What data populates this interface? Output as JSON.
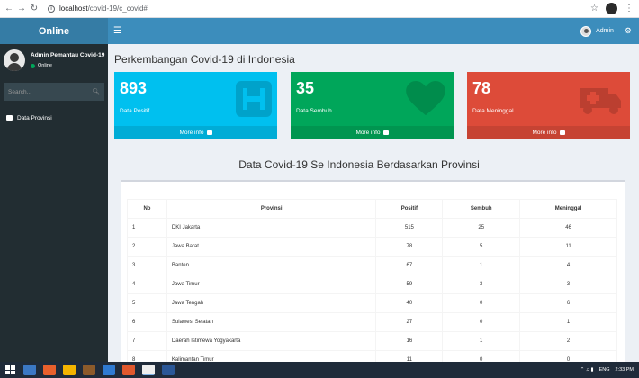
{
  "browser": {
    "url_host": "localhost",
    "url_path": "/covid-19/c_covid#"
  },
  "header": {
    "logo": "Online",
    "user_name": "Admin"
  },
  "sidebar": {
    "user_name": "Admin Pemantau Covid-19",
    "status": "Online",
    "search_placeholder": "Search...",
    "menu": [
      {
        "label": "Data Provinsi",
        "icon": "book-icon"
      }
    ]
  },
  "main": {
    "title": "Perkembangan Covid-19 di Indonesia",
    "boxes": [
      {
        "value": "893",
        "label": "Data Positif",
        "footer": "More info",
        "color": "#00c0ef",
        "icon": "hospital-icon"
      },
      {
        "value": "35",
        "label": "Data Sembuh",
        "footer": "More info",
        "color": "#00a65a",
        "icon": "heart-icon"
      },
      {
        "value": "78",
        "label": "Data Meninggal",
        "footer": "More info",
        "color": "#dd4b39",
        "icon": "ambulance-icon"
      }
    ],
    "table_title": "Data Covid-19 Se Indonesia Berdasarkan Provinsi",
    "table": {
      "headers": [
        "No",
        "Provinsi",
        "Positif",
        "Sembuh",
        "Meninggal"
      ],
      "rows": [
        [
          "1",
          "DKI Jakarta",
          "515",
          "25",
          "46"
        ],
        [
          "2",
          "Jawa Barat",
          "78",
          "5",
          "11"
        ],
        [
          "3",
          "Banten",
          "67",
          "1",
          "4"
        ],
        [
          "4",
          "Jawa Timur",
          "59",
          "3",
          "3"
        ],
        [
          "5",
          "Jawa Tengah",
          "40",
          "0",
          "6"
        ],
        [
          "6",
          "Sulawesi Selatan",
          "27",
          "0",
          "1"
        ],
        [
          "7",
          "Daerah Istimewa Yogyakarta",
          "16",
          "1",
          "2"
        ],
        [
          "8",
          "Kalimantan Timur",
          "11",
          "0",
          "0"
        ]
      ]
    }
  },
  "taskbar": {
    "language": "ENG",
    "time": "2:33 PM"
  }
}
